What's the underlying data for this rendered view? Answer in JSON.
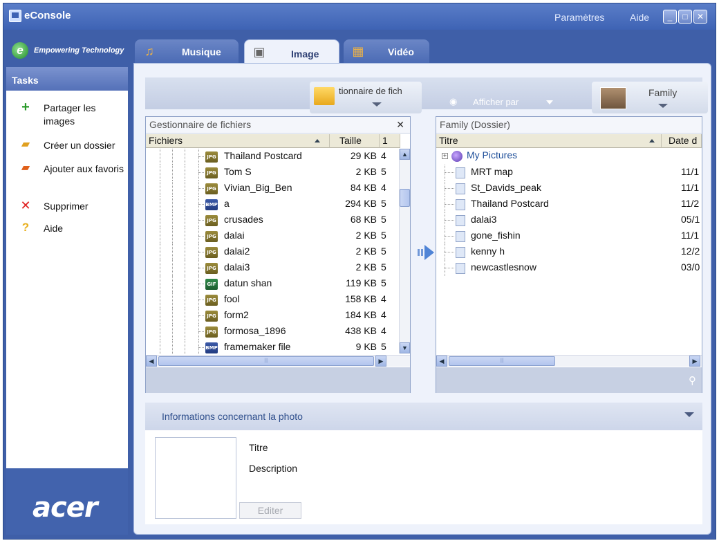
{
  "app": {
    "title": "eConsole",
    "tagline": "Empowering Technology",
    "brand": "acer"
  },
  "titlebar": {
    "parametres": "Paramètres",
    "aide": "Aide"
  },
  "tabs": [
    {
      "label": "Musique"
    },
    {
      "label": "Image",
      "selected": true
    },
    {
      "label": "Vidéo"
    }
  ],
  "sidebar": {
    "header": "Tasks",
    "tasks": [
      {
        "label": "Partager les images",
        "icon": "plus-icon"
      },
      {
        "label": "Créer un dossier",
        "icon": "new-folder-icon"
      },
      {
        "label": "Ajouter aux favoris",
        "icon": "favorites-folder-icon"
      },
      {
        "label": "Supprimer",
        "icon": "delete-icon"
      },
      {
        "label": "Aide",
        "icon": "help-icon"
      }
    ]
  },
  "toolbar": {
    "left_dropdown": "tionnaire de fich",
    "afficher": "Afficher par",
    "right_dropdown": "Family"
  },
  "left_panel": {
    "title": "Gestionnaire de fichiers",
    "columns": [
      "Fichiers",
      "Taille",
      "1"
    ],
    "rows": [
      {
        "name": "Thailand Postcard",
        "size": "29 KB",
        "extra": "4",
        "type": "jpg"
      },
      {
        "name": "Tom S",
        "size": "2 KB",
        "extra": "5",
        "type": "jpg"
      },
      {
        "name": "Vivian_Big_Ben",
        "size": "84 KB",
        "extra": "4",
        "type": "jpg"
      },
      {
        "name": "a",
        "size": "294 KB",
        "extra": "5",
        "type": "bmp"
      },
      {
        "name": "crusades",
        "size": "68 KB",
        "extra": "5",
        "type": "jpg"
      },
      {
        "name": "dalai",
        "size": "2 KB",
        "extra": "5",
        "type": "jpg"
      },
      {
        "name": "dalai2",
        "size": "2 KB",
        "extra": "5",
        "type": "jpg"
      },
      {
        "name": "dalai3",
        "size": "2 KB",
        "extra": "5",
        "type": "jpg"
      },
      {
        "name": "datun shan",
        "size": "119 KB",
        "extra": "5",
        "type": "gif"
      },
      {
        "name": "fool",
        "size": "158 KB",
        "extra": "4",
        "type": "jpg"
      },
      {
        "name": "form2",
        "size": "184 KB",
        "extra": "4",
        "type": "jpg"
      },
      {
        "name": "formosa_1896",
        "size": "438 KB",
        "extra": "4",
        "type": "jpg"
      },
      {
        "name": "framemaker file",
        "size": "9 KB",
        "extra": "5",
        "type": "bmp"
      }
    ]
  },
  "right_panel": {
    "title": "Family (Dossier)",
    "columns": [
      "Titre",
      "Date d"
    ],
    "root": "My Pictures",
    "rows": [
      {
        "name": "MRT map",
        "date": "11/1"
      },
      {
        "name": "St_Davids_peak",
        "date": "11/1"
      },
      {
        "name": "Thailand Postcard",
        "date": "11/2"
      },
      {
        "name": "dalai3",
        "date": "05/1"
      },
      {
        "name": "gone_fishin",
        "date": "11/1"
      },
      {
        "name": "kenny h",
        "date": "12/2"
      },
      {
        "name": "newcastlesnow",
        "date": "03/0"
      }
    ]
  },
  "photo_info": {
    "title": "Informations concernant la photo",
    "titre_label": "Titre",
    "description_label": "Description",
    "edit_button": "Editer"
  },
  "colors": {
    "window": "#3f5fa8",
    "accent": "#2f4f8c",
    "panel": "#eef2fb"
  }
}
